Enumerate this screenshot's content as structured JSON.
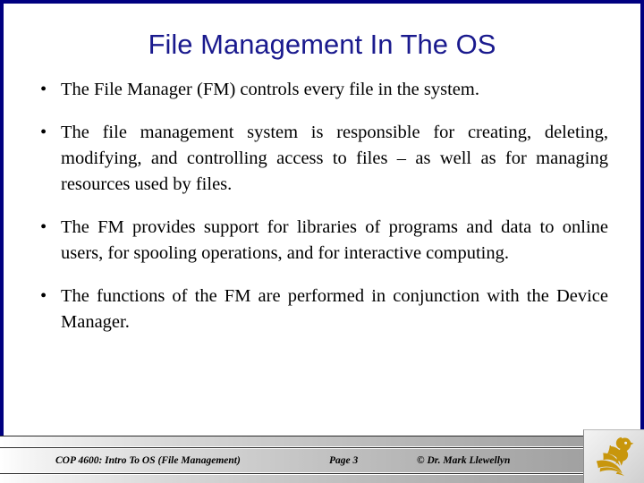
{
  "slide": {
    "title": "File Management In The OS",
    "accent_title_color": "#1a1a8e",
    "frame_color": "#000080",
    "bullet_glyph": "•",
    "bullets": [
      "The File Manager (FM) controls every file in the system.",
      "The file management system is responsible for creating, deleting, modifying, and controlling access to files – as well as for managing resources used by files.",
      "The FM provides support for libraries of programs and data to online users, for spooling operations, and for interactive computing.",
      "The functions of the FM are performed in conjunction with the Device Manager."
    ]
  },
  "footer": {
    "course": "COP 4600: Intro To OS  (File Management)",
    "page": "Page 3",
    "copyright": "© Dr. Mark Llewellyn",
    "logo_name": "ucf-pegasus-logo",
    "logo_color": "#c8960c"
  }
}
